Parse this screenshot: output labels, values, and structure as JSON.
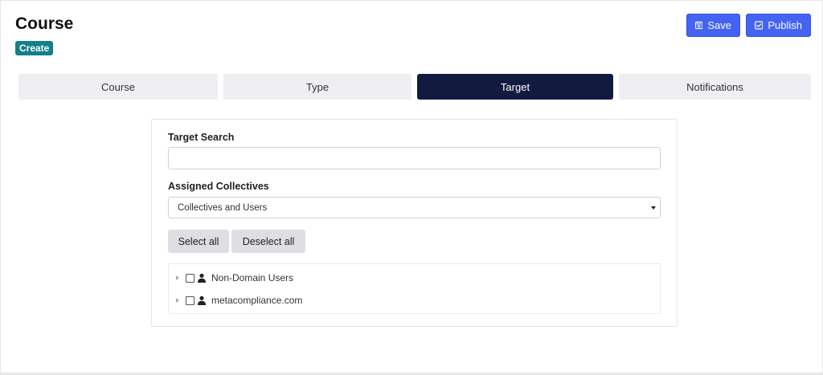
{
  "header": {
    "title": "Course",
    "badge": "Create",
    "save_label": "Save",
    "publish_label": "Publish"
  },
  "tabs": [
    {
      "label": "Course",
      "active": false
    },
    {
      "label": "Type",
      "active": false
    },
    {
      "label": "Target",
      "active": true
    },
    {
      "label": "Notifications",
      "active": false
    }
  ],
  "target": {
    "search_label": "Target Search",
    "search_value": "",
    "collectives_label": "Assigned Collectives",
    "collectives_selected": "Collectives and Users",
    "select_all_label": "Select all",
    "deselect_all_label": "Deselect all",
    "tree_items": [
      {
        "label": "Non-Domain Users",
        "checked": false,
        "icon": "user-icon"
      },
      {
        "label": "metacompliance.com",
        "checked": false,
        "icon": "user-icon"
      }
    ]
  },
  "colors": {
    "primary": "#4463f2",
    "active_tab": "#131a3f",
    "badge": "#137f8a",
    "tab_bg": "#efeff2"
  }
}
